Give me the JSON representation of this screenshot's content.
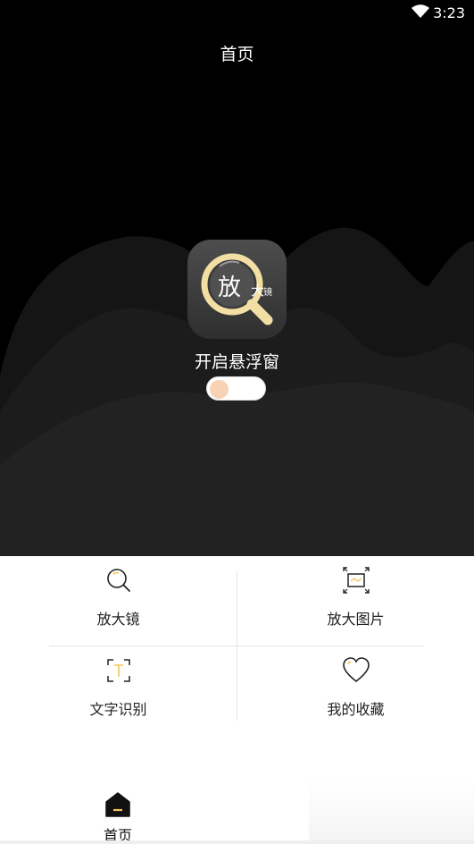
{
  "status_bar": {
    "time": "3:23",
    "wifi_icon": "wifi-icon"
  },
  "header": {
    "title": "首页"
  },
  "app_icon": {
    "main_char": "放",
    "small_char": "大",
    "tiny_char": "镜",
    "icon": "magnifier-icon"
  },
  "float_window": {
    "label": "开启悬浮窗",
    "toggle_on": false,
    "accent": "#f7d2b5"
  },
  "features": [
    {
      "label": "放大镜",
      "icon": "magnifier-icon"
    },
    {
      "label": "放大图片",
      "icon": "enlarge-image-icon"
    },
    {
      "label": "文字识别",
      "icon": "text-recognition-icon"
    },
    {
      "label": "我的收藏",
      "icon": "heart-icon"
    }
  ],
  "bottom_nav": {
    "home_label": "首页",
    "home_icon": "home-icon"
  },
  "colors": {
    "accent": "#f5c45a",
    "hero_bg": "#000000",
    "mountain": "#1a1a1a"
  }
}
